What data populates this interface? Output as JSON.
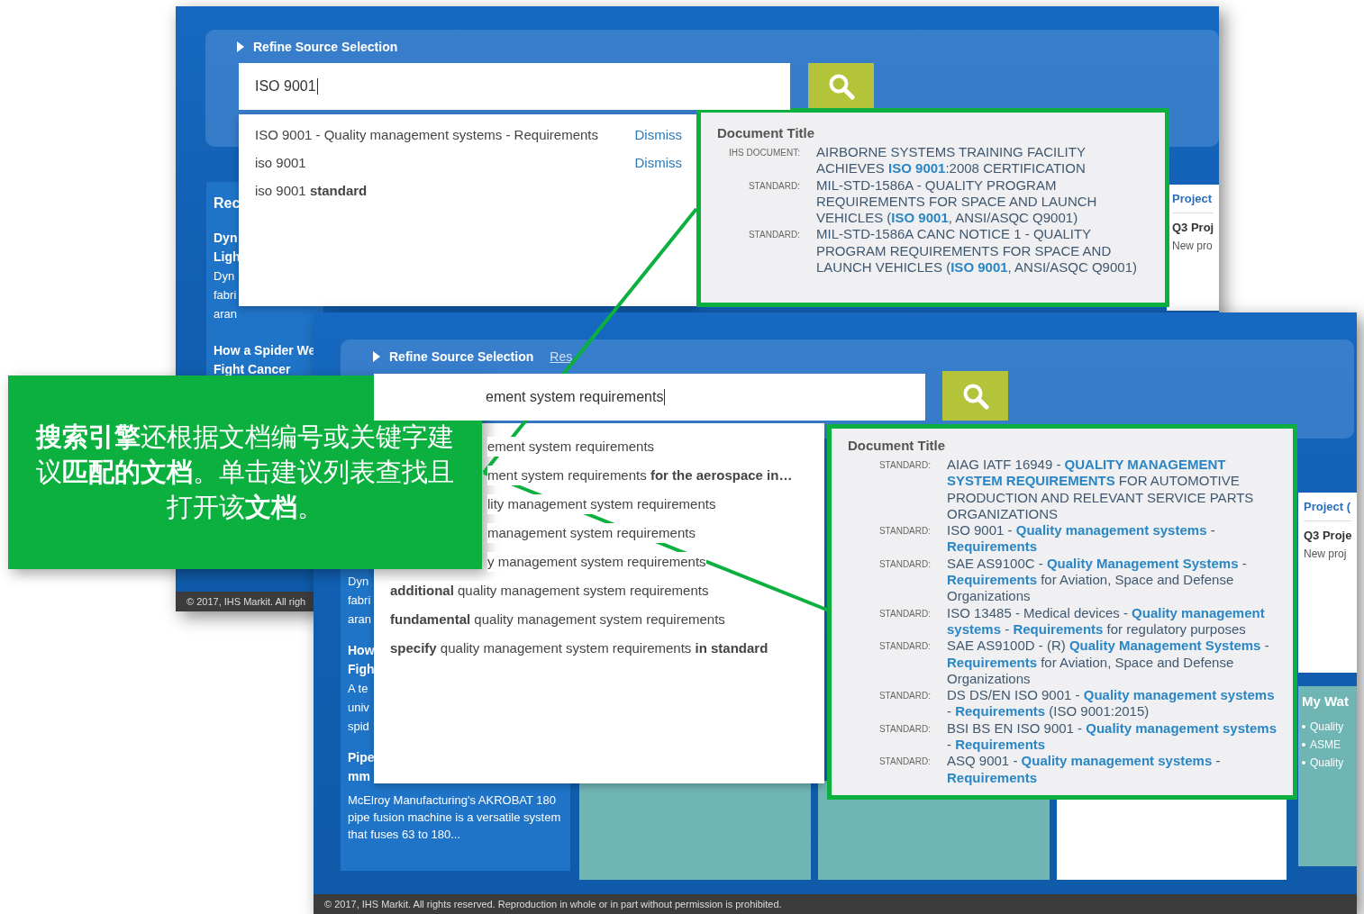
{
  "back_screenshot": {
    "refine_label": "Refine Source Selection",
    "search": {
      "value": "ISO 9001"
    },
    "suggestions": [
      {
        "text": "ISO 9001 - Quality management systems - Requirements",
        "action": "Dismiss"
      },
      {
        "text": "iso 9001",
        "action": "Dismiss"
      },
      {
        "text": "iso 9001 **standard**"
      }
    ],
    "sidebar": [
      {
        "text": "Rec",
        "kind": "heading"
      },
      {
        "text": "Dyn",
        "kind": "title"
      },
      {
        "text": "Ligh",
        "kind": "title"
      },
      {
        "text": "Dyn",
        "kind": "body"
      },
      {
        "text": "fabri",
        "kind": "body"
      },
      {
        "text": "aran",
        "kind": "body"
      },
      {
        "text": "How a Spider We",
        "kind": "title"
      },
      {
        "text": "Fight Cancer",
        "kind": "title"
      }
    ],
    "project_card": {
      "title": "Project",
      "item_title": "Q3 Proj",
      "item_text": "New pro"
    },
    "footer": "© 2017, IHS Markit. All righ",
    "document_popup": {
      "heading": "Document Title",
      "results": [
        {
          "type": "IHS DOCUMENT:",
          "title": "AIRBORNE SYSTEMS TRAINING FACILITY ACHIEVES **ISO 9001**:2008 CERTIFICATION"
        },
        {
          "type": "STANDARD:",
          "title": "MIL-STD-1586A - QUALITY PROGRAM REQUIREMENTS FOR SPACE AND LAUNCH VEHICLES (**ISO 9001**, ANSI/ASQC Q9001)"
        },
        {
          "type": "STANDARD:",
          "title": "MIL-STD-1586A CANC NOTICE 1 - QUALITY PROGRAM REQUIREMENTS FOR SPACE AND LAUNCH VEHICLES (**ISO 9001**, ANSI/ASQC Q9001)"
        }
      ]
    }
  },
  "front_screenshot": {
    "refine_label": "Refine Source Selection",
    "reset_link": "Res",
    "search": {
      "value": "ement system requirements"
    },
    "suggestions": [
      {
        "text": "ement system requirements"
      },
      {
        "text": "ment system requirements **for the aerospace in…**"
      },
      {
        "text": "lity management system requirements"
      },
      {
        "text": "management system requirements"
      },
      {
        "text": "y management system requirements"
      },
      {
        "text": "**additional** quality management system requirements"
      },
      {
        "text": "**fundamental** quality management system requirements"
      },
      {
        "text": "**specify** quality management system requirements **in standard**"
      }
    ],
    "sidebar": [
      {
        "text": "Dyn",
        "kind": "body"
      },
      {
        "text": "fabri",
        "kind": "body"
      },
      {
        "text": "aran",
        "kind": "body"
      },
      {
        "text": "How",
        "kind": "title"
      },
      {
        "text": "Figh",
        "kind": "title"
      },
      {
        "text": "A te",
        "kind": "body"
      },
      {
        "text": "univ",
        "kind": "body"
      },
      {
        "text": "spid",
        "kind": "body"
      },
      {
        "text": "Pipe",
        "kind": "title"
      },
      {
        "text": "mm",
        "kind": "title"
      },
      {
        "text": "McElroy Manufacturing's AKROBAT 180 pipe fusion machine is a versatile system that fuses 63 to 180...",
        "kind": "body"
      }
    ],
    "project_card": {
      "title": "Project (",
      "item_title": "Q3 Proje",
      "item_text": "New proj"
    },
    "watch_card": {
      "title": "My Wat",
      "items": [
        "Quality",
        "ASME",
        "Quality"
      ]
    },
    "footer": "© 2017, IHS Markit. All rights reserved. Reproduction in whole or in part without permission is prohibited.",
    "document_popup": {
      "heading": "Document Title",
      "results": [
        {
          "type": "STANDARD:",
          "title": "AIAG IATF 16949 - **QUALITY MANAGEMENT SYSTEM REQUIREMENTS** FOR AUTOMOTIVE PRODUCTION AND RELEVANT SERVICE PARTS ORGANIZATIONS"
        },
        {
          "type": "STANDARD:",
          "title": "ISO 9001 - **Quality management systems** - **Requirements**"
        },
        {
          "type": "STANDARD:",
          "title": "SAE AS9100C - **Quality Management Systems** - **Requirements** for Aviation, Space and Defense Organizations"
        },
        {
          "type": "STANDARD:",
          "title": "ISO 13485 - Medical devices - **Quality management systems** - **Requirements** for regulatory purposes"
        },
        {
          "type": "STANDARD:",
          "title": "SAE AS9100D - (R) **Quality Management Systems** - **Requirements** for Aviation, Space and Defense Organizations"
        },
        {
          "type": "STANDARD:",
          "title": "DS DS/EN ISO 9001 - **Quality management systems** - **Requirements** (ISO 9001:2015)"
        },
        {
          "type": "STANDARD:",
          "title": "BSI BS EN ISO 9001 - **Quality management systems** - **Requirements**"
        },
        {
          "type": "STANDARD:",
          "title": "ASQ 9001 - **Quality management systems** - **Requirements**"
        }
      ]
    }
  },
  "callout": {
    "text": "**搜索引擎**还根据文档编号或关键字建议**匹配的文档**。单击建议列表查找且打开该**文档**。"
  }
}
